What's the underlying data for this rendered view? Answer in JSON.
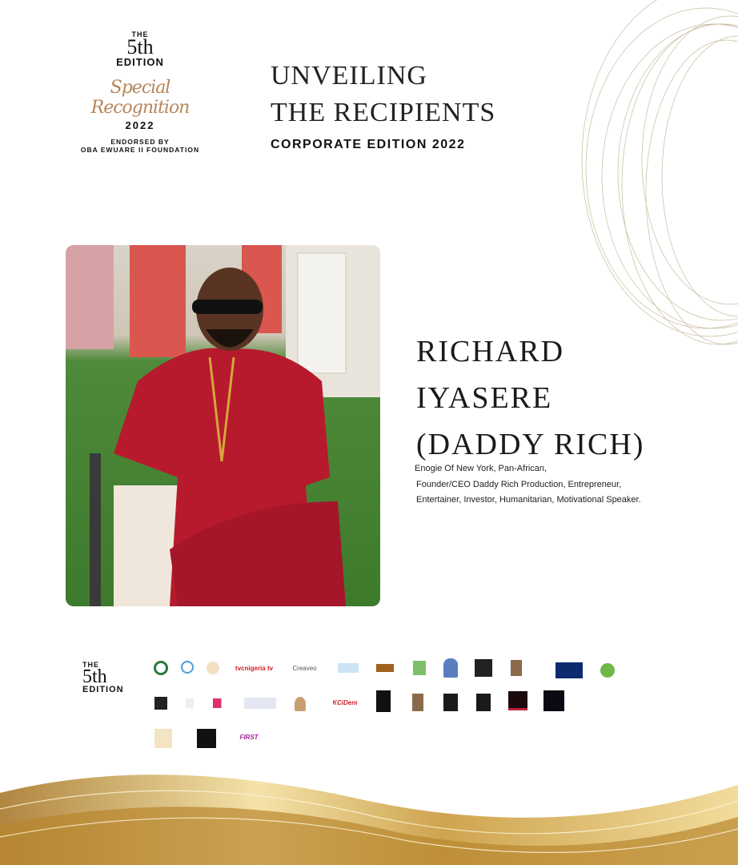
{
  "logo": {
    "the": "THE",
    "number": "5th",
    "edition": "EDITION",
    "script": "Special Recognition",
    "year": "2022",
    "endorsed_line1": "ENDORSED BY",
    "endorsed_line2": "OBA EWUARE II FOUNDATION"
  },
  "header": {
    "line1": "UNVEILING",
    "line2": "THE RECIPIENTS",
    "subtitle": "CORPORATE EDITION 2022"
  },
  "recipient": {
    "name_line1": "RICHARD",
    "name_line2": "IYASERE",
    "name_line3": "(DADDY RICH)",
    "description": [
      "Enogie Of New York, Pan-African,",
      "Founder/CEO Daddy Rich Production, Entrepreneur,",
      "Entertainer, Investor, Humanitarian, Motivational Speaker."
    ]
  },
  "footer_logo": {
    "the": "THE",
    "number": "5th",
    "edition": "EDITION"
  },
  "sponsors": [
    {
      "text": "tvcnigeria tv",
      "color": "#2fa84f"
    },
    {
      "text": "Creaveo",
      "color": "#f2b400"
    },
    {
      "text": "KCiDent",
      "color": "#d0202a"
    },
    {
      "text": "FIRST",
      "color": "#8a2da0"
    }
  ],
  "colors": {
    "gold": "#c9a24a",
    "script": "#b8865a"
  }
}
